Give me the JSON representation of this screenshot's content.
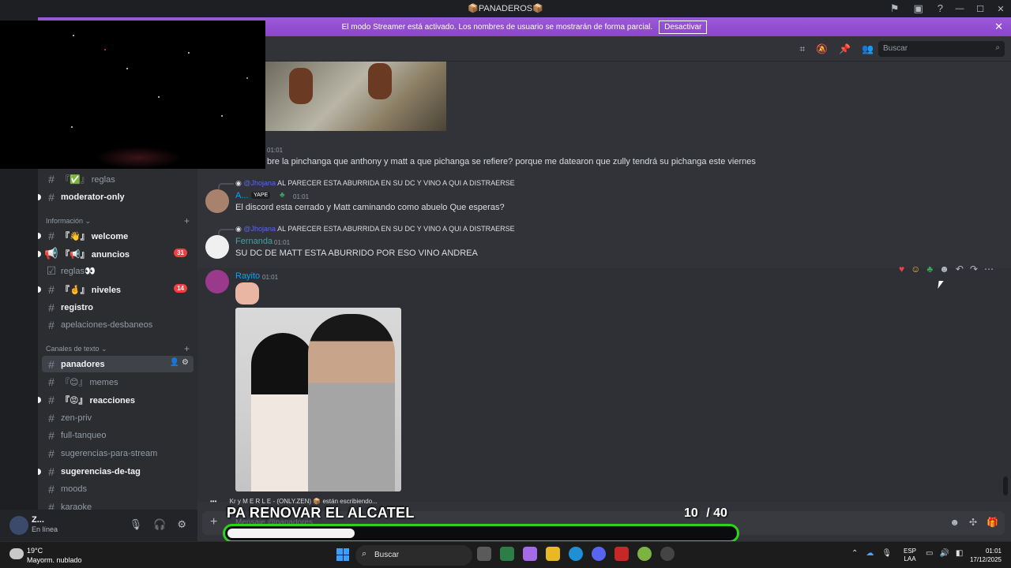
{
  "window": {
    "title": "📦PANADEROS📦"
  },
  "banner": {
    "text": "El modo Streamer está activado. Los nombres de usuario se mostrarán de forma parcial.",
    "button": "Desactivar"
  },
  "header": {
    "search_placeholder": "Buscar"
  },
  "sidebar": {
    "channels_top": [
      {
        "label": "『✅』 reglas",
        "state": "read"
      },
      {
        "label": "moderator-only",
        "state": "unread"
      }
    ],
    "category_info": "Información",
    "channels_info": [
      {
        "label": "『👋』 welcome",
        "state": "unread"
      },
      {
        "label": "『📢』 anuncios",
        "state": "unread",
        "badge": "31"
      },
      {
        "label": "reglas👀",
        "state": "read"
      },
      {
        "label": "『🤞』 niveles",
        "state": "unread",
        "badge": "14"
      },
      {
        "label": "registro",
        "state": "unread"
      },
      {
        "label": "apelaciones-desbaneos",
        "state": "read"
      }
    ],
    "category_text": "Canales de texto",
    "channels_text": [
      {
        "label": "panadores",
        "state": "active"
      },
      {
        "label": "『😊』 memes",
        "state": "read"
      },
      {
        "label": "『😡』 reacciones",
        "state": "unread"
      },
      {
        "label": "zen-priv",
        "state": "read"
      },
      {
        "label": "full-tanqueo",
        "state": "read"
      },
      {
        "label": "sugerencias-para-stream",
        "state": "read"
      },
      {
        "label": "sugerencias-de-tag",
        "state": "unread"
      },
      {
        "label": "moods",
        "state": "read"
      },
      {
        "label": "karaoke",
        "state": "read"
      }
    ]
  },
  "user": {
    "name": "Z...",
    "status": "En línea"
  },
  "messages": {
    "m1": {
      "time": "01:01",
      "text": "bre la pinchanga que anthony y matt a que pichanga se refiere? porque me datearon que zully tendrá su pichanga este viernes"
    },
    "m2": {
      "reply_mention": "@Jhojana",
      "reply_text": "AL PARECER ESTA ABURRIDA EN SU DC Y VINO A QUI A DISTRAERSE",
      "author": "A...",
      "tag": "YAPE",
      "time": "01:01",
      "text": "El discord esta cerrado y Matt caminando como abuelo Que esperas?"
    },
    "m3": {
      "reply_mention": "@Jhojana",
      "reply_text": "AL PARECER ESTA ABURRIDA EN SU DC Y VINO A QUI A DISTRAERSE",
      "author": "Fernanda",
      "time": "01:01",
      "text": "SU DC DE MATT ESTA ABURRIDO POR ESO VINO ANDREA"
    },
    "m4": {
      "author": "Rayito",
      "time": "01:01"
    }
  },
  "typing": "Kr y M E R L E - (ONLY.ZEN) 📦 están escribiendo...",
  "composer": {
    "placeholder": "Mensaje @panadores"
  },
  "overlay": {
    "title": "PA RENOVAR EL ALCATEL",
    "current": "10",
    "total": "/ 40",
    "progress_fraction": 0.25
  },
  "taskbar": {
    "weather_temp": "19°C",
    "weather_desc": "Mayorm. nublado",
    "search": "Buscar",
    "lang1": "ESP",
    "lang2": "LAA",
    "time": "01:01",
    "date": "17/12/2025"
  },
  "colors": {
    "accent": "#5865f2",
    "streamer_banner": "#9b59d6",
    "progress_border": "#2fd11f",
    "badge": "#f23f43",
    "mention": "#5865f2",
    "rayito": "#00a8fc"
  }
}
